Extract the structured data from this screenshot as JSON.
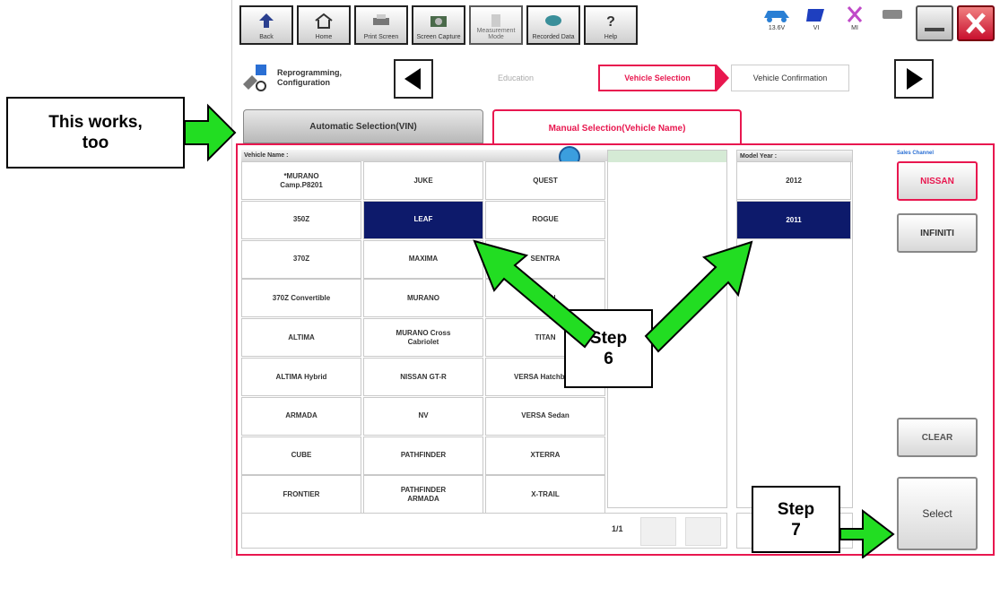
{
  "toolbar": {
    "back": "Back",
    "home": "Home",
    "print_screen": "Print Screen",
    "screen_capture": "Screen Capture",
    "measurement_mode": "Measurement Mode",
    "recorded_data": "Recorded Data",
    "help": "Help",
    "battery": "13.6V",
    "vi": "VI",
    "mi": "MI"
  },
  "breadcrumb": {
    "section": "Reprogramming, Configuration",
    "step_prev": "Education",
    "step_current": "Vehicle Selection",
    "step_next": "Vehicle Confirmation"
  },
  "tabs": {
    "automatic": "Automatic Selection(VIN)",
    "manual": "Manual Selection(Vehicle Name)"
  },
  "vehicle_panel": {
    "header": "Vehicle Name :",
    "rows": [
      [
        "*MURANO\nCamp.P8201",
        "JUKE",
        "QUEST"
      ],
      [
        "350Z",
        "LEAF",
        "ROGUE"
      ],
      [
        "370Z",
        "MAXIMA",
        "SENTRA"
      ],
      [
        "370Z Convertible",
        "MURANO",
        "TITAN"
      ],
      [
        "ALTIMA",
        "MURANO Cross\nCabriolet",
        "TITAN"
      ],
      [
        "ALTIMA Hybrid",
        "NISSAN GT-R",
        "VERSA Hatchback"
      ],
      [
        "ARMADA",
        "NV",
        "VERSA Sedan"
      ],
      [
        "CUBE",
        "PATHFINDER",
        "XTERRA"
      ],
      [
        "FRONTIER",
        "PATHFINDER\nARMADA",
        "X-TRAIL"
      ]
    ],
    "selected": "LEAF",
    "page": "1/1"
  },
  "model_year": {
    "header": "Model Year :",
    "years": [
      "2012",
      "2011"
    ],
    "selected": "2011"
  },
  "brand": {
    "header": "Sales Channel",
    "nissan": "NISSAN",
    "infiniti": "INFINITI"
  },
  "buttons": {
    "clear": "CLEAR",
    "select": "Select"
  },
  "callouts": {
    "this_works": "This works,\ntoo",
    "step6": "Step\n6",
    "step7": "Step\n7"
  },
  "colors": {
    "accent": "#e8174f",
    "selected": "#0d1a6b",
    "arrow": "#22dd22"
  }
}
